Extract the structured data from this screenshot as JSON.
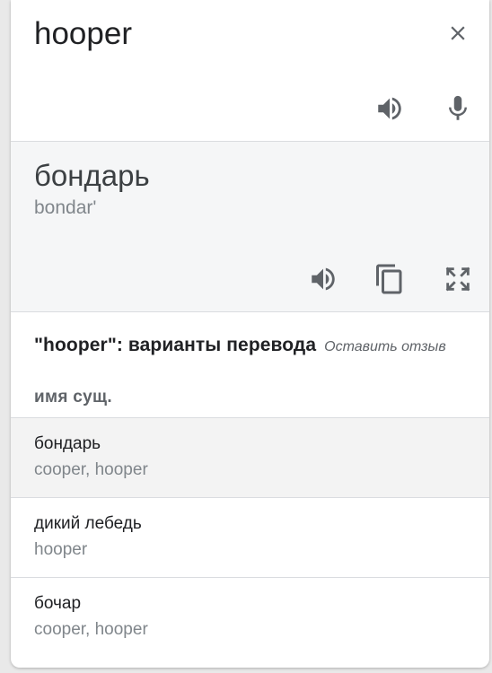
{
  "source": {
    "text": "hooper",
    "icons": {
      "clear": "close-icon",
      "listen": "speaker-icon",
      "voice": "microphone-icon"
    }
  },
  "translation": {
    "text": "бондарь",
    "transliteration": "bondar'",
    "icons": {
      "listen": "speaker-icon",
      "copy": "copy-icon",
      "fullscreen": "fullscreen-icon"
    }
  },
  "alternatives": {
    "title": "\"hooper\": варианты перевода",
    "feedback_link": "Оставить отзыв",
    "part_of_speech": "имя сущ.",
    "items": [
      {
        "word": "бондарь",
        "synonyms": "cooper, hooper"
      },
      {
        "word": "дикий лебедь",
        "synonyms": "hooper"
      },
      {
        "word": "бочар",
        "synonyms": "cooper, hooper"
      }
    ]
  },
  "colors": {
    "icon": "#5f6368",
    "translation_bg": "#f5f6f7",
    "divider": "#dadce0"
  }
}
